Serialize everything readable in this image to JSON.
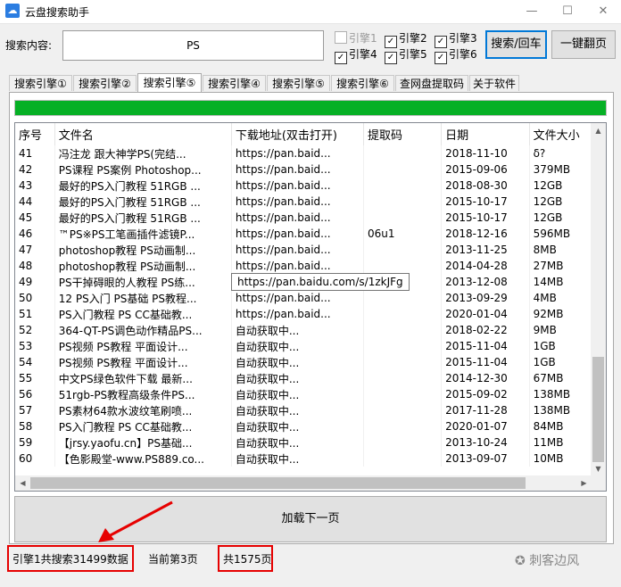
{
  "window": {
    "title": "云盘搜索助手",
    "minimize": "—",
    "maximize": "☐",
    "close": "✕"
  },
  "search": {
    "label": "搜索内容:",
    "value": "PS",
    "engines": [
      {
        "label": "引擎1",
        "checked": false,
        "disabled": true
      },
      {
        "label": "引擎2",
        "checked": true
      },
      {
        "label": "引擎3",
        "checked": true
      },
      {
        "label": "引擎4",
        "checked": true
      },
      {
        "label": "引擎5",
        "checked": true
      },
      {
        "label": "引擎6",
        "checked": true
      }
    ],
    "search_button": "搜索/回车",
    "page_button": "一键翻页"
  },
  "tabs": [
    {
      "label": "搜索引擎①",
      "active": false
    },
    {
      "label": "搜索引擎②",
      "active": false
    },
    {
      "label": "搜索引擎⑤",
      "active": true
    },
    {
      "label": "搜索引擎④",
      "active": false
    },
    {
      "label": "搜索引擎⑤",
      "active": false
    },
    {
      "label": "搜索引擎⑥",
      "active": false
    },
    {
      "label": "查网盘提取码",
      "active": false
    },
    {
      "label": "关于软件",
      "active": false
    }
  ],
  "progress": {
    "percent": 100,
    "color": "#06b025"
  },
  "table": {
    "columns": [
      "序号",
      "文件名",
      "下载地址(双击打开)",
      "提取码",
      "日期",
      "文件大小"
    ],
    "rows": [
      [
        "41",
        "冯注龙 跟大神学PS(完结...",
        "https://pan.baid...",
        "",
        "2018-11-10",
        "δ?"
      ],
      [
        "42",
        "PS课程 PS案例 Photoshop...",
        "https://pan.baid...",
        "",
        "2015-09-06",
        "379MB"
      ],
      [
        "43",
        "最好的PS入门教程 51RGB ...",
        "https://pan.baid...",
        "",
        "2018-08-30",
        "12GB"
      ],
      [
        "44",
        "最好的PS入门教程 51RGB ...",
        "https://pan.baid...",
        "",
        "2015-10-17",
        "12GB"
      ],
      [
        "45",
        "最好的PS入门教程 51RGB ...",
        "https://pan.baid...",
        "",
        "2015-10-17",
        "12GB"
      ],
      [
        "46",
        "™PS※PS工笔画插件滤镜P...",
        "https://pan.baid...",
        "06u1",
        "2018-12-16",
        "596MB"
      ],
      [
        "47",
        "photoshop教程 PS动画制...",
        "https://pan.baid...",
        "",
        "2013-11-25",
        "8MB"
      ],
      [
        "48",
        "photoshop教程 PS动画制...",
        "https://pan.baid...",
        "",
        "2014-04-28",
        "27MB"
      ],
      [
        "49",
        "PS干掉碍眼的人教程 PS练...",
        "https://pan.baid...",
        "",
        "2013-12-08",
        "14MB"
      ],
      [
        "50",
        "12 PS入门 PS基础 PS教程...",
        "https://pan.baid...",
        "",
        "2013-09-29",
        "4MB"
      ],
      [
        "51",
        "PS入门教程 PS CC基础教...",
        "https://pan.baid...",
        "",
        "2020-01-04",
        "92MB"
      ],
      [
        "52",
        "364-QT-PS调色动作精品PS...",
        "自动获取中...",
        "",
        "2018-02-22",
        "9MB"
      ],
      [
        "53",
        "PS视频 PS教程 平面设计...",
        "自动获取中...",
        "",
        "2015-11-04",
        "1GB"
      ],
      [
        "54",
        "PS视频 PS教程 平面设计...",
        "自动获取中...",
        "",
        "2015-11-04",
        "1GB"
      ],
      [
        "55",
        "中文PS绿色软件下载 最新...",
        "自动获取中...",
        "",
        "2014-12-30",
        "67MB"
      ],
      [
        "56",
        "51rgb-PS教程高级条件PS...",
        "自动获取中...",
        "",
        "2015-09-02",
        "138MB"
      ],
      [
        "57",
        "PS素材64款水波纹笔刷喷...",
        "自动获取中...",
        "",
        "2017-11-28",
        "138MB"
      ],
      [
        "58",
        "PS入门教程 PS CC基础教...",
        "自动获取中...",
        "",
        "2020-01-07",
        "84MB"
      ],
      [
        "59",
        "【jrsy.yaofu.cn】PS基础...",
        "自动获取中...",
        "",
        "2013-10-24",
        "11MB"
      ],
      [
        "60",
        "【色影殿堂-www.PS889.co...",
        "自动获取中...",
        "",
        "2013-09-07",
        "10MB"
      ]
    ],
    "tooltip": "https://pan.baidu.com/s/1zkJFg"
  },
  "load_more": "加载下一页",
  "status": {
    "total": "引擎1共搜索31499数据",
    "current": "当前第3页",
    "pages": "共1575页"
  },
  "watermark": "刺客边风",
  "colors": {
    "highlight": "#e60000",
    "accent": "#0078d7"
  }
}
